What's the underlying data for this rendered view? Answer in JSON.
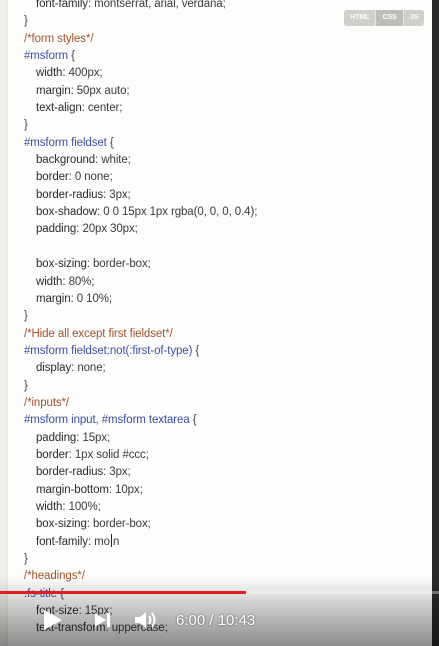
{
  "editor": {
    "language_tabs": [
      "HTML",
      "CSS",
      "JS"
    ],
    "active_tab": "CSS",
    "lines": [
      {
        "indent": 1,
        "parts": [
          [
            "prop",
            "font-family"
          ],
          [
            "punc",
            ": "
          ],
          [
            "val",
            "montserrat, arial, verdana"
          ],
          [
            "punc",
            ";"
          ]
        ]
      },
      {
        "indent": 0,
        "parts": [
          [
            "punc",
            "}"
          ]
        ]
      },
      {
        "indent": 0,
        "parts": [
          [
            "cmt",
            "/*form styles*/"
          ]
        ]
      },
      {
        "indent": 0,
        "parts": [
          [
            "sel",
            "#msform"
          ],
          [
            "punc",
            " {"
          ]
        ]
      },
      {
        "indent": 1,
        "parts": [
          [
            "prop",
            "width"
          ],
          [
            "punc",
            ": "
          ],
          [
            "val",
            "400px"
          ],
          [
            "punc",
            ";"
          ]
        ]
      },
      {
        "indent": 1,
        "parts": [
          [
            "prop",
            "margin"
          ],
          [
            "punc",
            ": "
          ],
          [
            "val",
            "50px auto"
          ],
          [
            "punc",
            ";"
          ]
        ]
      },
      {
        "indent": 1,
        "parts": [
          [
            "prop",
            "text-align"
          ],
          [
            "punc",
            ": "
          ],
          [
            "val",
            "center"
          ],
          [
            "punc",
            ";"
          ]
        ]
      },
      {
        "indent": 0,
        "parts": [
          [
            "punc",
            "}"
          ]
        ]
      },
      {
        "indent": 0,
        "parts": [
          [
            "sel",
            "#msform fieldset"
          ],
          [
            "punc",
            " {"
          ]
        ]
      },
      {
        "indent": 1,
        "parts": [
          [
            "prop",
            "background"
          ],
          [
            "punc",
            ": "
          ],
          [
            "val",
            "white"
          ],
          [
            "punc",
            ";"
          ]
        ]
      },
      {
        "indent": 1,
        "parts": [
          [
            "prop",
            "border"
          ],
          [
            "punc",
            ": "
          ],
          [
            "val",
            "0 none"
          ],
          [
            "punc",
            ";"
          ]
        ]
      },
      {
        "indent": 1,
        "parts": [
          [
            "prop",
            "border-radius"
          ],
          [
            "punc",
            ": "
          ],
          [
            "val",
            "3px"
          ],
          [
            "punc",
            ";"
          ]
        ]
      },
      {
        "indent": 1,
        "parts": [
          [
            "prop",
            "box-shadow"
          ],
          [
            "punc",
            ": "
          ],
          [
            "val",
            "0 0 15px 1px rgba(0, 0, 0, 0.4)"
          ],
          [
            "punc",
            ";"
          ]
        ]
      },
      {
        "indent": 1,
        "parts": [
          [
            "prop",
            "padding"
          ],
          [
            "punc",
            ": "
          ],
          [
            "val",
            "20px 30px"
          ],
          [
            "punc",
            ";"
          ]
        ]
      },
      {
        "indent": 0,
        "parts": []
      },
      {
        "indent": 1,
        "parts": [
          [
            "prop",
            "box-sizing"
          ],
          [
            "punc",
            ": "
          ],
          [
            "val",
            "border-box"
          ],
          [
            "punc",
            ";"
          ]
        ]
      },
      {
        "indent": 1,
        "parts": [
          [
            "prop",
            "width"
          ],
          [
            "punc",
            ": "
          ],
          [
            "val",
            "80%"
          ],
          [
            "punc",
            ";"
          ]
        ]
      },
      {
        "indent": 1,
        "parts": [
          [
            "prop",
            "margin"
          ],
          [
            "punc",
            ": "
          ],
          [
            "val",
            "0 10%"
          ],
          [
            "punc",
            ";"
          ]
        ]
      },
      {
        "indent": 0,
        "parts": [
          [
            "punc",
            "}"
          ]
        ]
      },
      {
        "indent": 0,
        "parts": [
          [
            "cmt",
            "/*Hide all except first fieldset*/"
          ]
        ]
      },
      {
        "indent": 0,
        "parts": [
          [
            "sel",
            "#msform fieldset:not(:first-of-type)"
          ],
          [
            "punc",
            " {"
          ]
        ]
      },
      {
        "indent": 1,
        "parts": [
          [
            "prop",
            "display"
          ],
          [
            "punc",
            ": "
          ],
          [
            "val",
            "none"
          ],
          [
            "punc",
            ";"
          ]
        ]
      },
      {
        "indent": 0,
        "parts": [
          [
            "punc",
            "}"
          ]
        ]
      },
      {
        "indent": 0,
        "parts": [
          [
            "cmt",
            "/*inputs*/"
          ]
        ]
      },
      {
        "indent": 0,
        "parts": [
          [
            "sel",
            "#msform input, #msform textarea"
          ],
          [
            "punc",
            " {"
          ]
        ]
      },
      {
        "indent": 1,
        "parts": [
          [
            "prop",
            "padding"
          ],
          [
            "punc",
            ": "
          ],
          [
            "val",
            "15px"
          ],
          [
            "punc",
            ";"
          ]
        ]
      },
      {
        "indent": 1,
        "parts": [
          [
            "prop",
            "border"
          ],
          [
            "punc",
            ": "
          ],
          [
            "val",
            "1px solid #ccc"
          ],
          [
            "punc",
            ";"
          ]
        ]
      },
      {
        "indent": 1,
        "parts": [
          [
            "prop",
            "border-radius"
          ],
          [
            "punc",
            ": "
          ],
          [
            "val",
            "3px"
          ],
          [
            "punc",
            ";"
          ]
        ]
      },
      {
        "indent": 1,
        "parts": [
          [
            "prop",
            "margin-bottom"
          ],
          [
            "punc",
            ": "
          ],
          [
            "val",
            "10px"
          ],
          [
            "punc",
            ";"
          ]
        ]
      },
      {
        "indent": 1,
        "parts": [
          [
            "prop",
            "width"
          ],
          [
            "punc",
            ": "
          ],
          [
            "val",
            "100%"
          ],
          [
            "punc",
            ";"
          ]
        ]
      },
      {
        "indent": 1,
        "parts": [
          [
            "prop",
            "box-sizing"
          ],
          [
            "punc",
            ": "
          ],
          [
            "val",
            "border-box"
          ],
          [
            "punc",
            ";"
          ]
        ]
      },
      {
        "indent": 1,
        "caret_after": 1,
        "parts": [
          [
            "prop",
            "font-family"
          ],
          [
            "punc",
            ": "
          ],
          [
            "val",
            "mo"
          ],
          [
            "val",
            "n"
          ]
        ]
      },
      {
        "indent": 0,
        "parts": [
          [
            "punc",
            "}"
          ]
        ]
      },
      {
        "indent": 0,
        "parts": [
          [
            "cmt",
            "/*headings*/"
          ]
        ]
      },
      {
        "indent": 0,
        "parts": [
          [
            "sel",
            ".fs-title"
          ],
          [
            "punc",
            " {"
          ]
        ]
      },
      {
        "indent": 1,
        "parts": [
          [
            "prop",
            "font-size"
          ],
          [
            "punc",
            ": "
          ],
          [
            "val",
            "15px"
          ],
          [
            "punc",
            ";"
          ]
        ]
      },
      {
        "indent": 1,
        "parts": [
          [
            "prop",
            "text-transform"
          ],
          [
            "punc",
            ": "
          ],
          [
            "val",
            "uppercase"
          ],
          [
            "punc",
            ";"
          ]
        ]
      }
    ]
  },
  "player": {
    "current_time": "6:00",
    "separator": " / ",
    "duration": "10:43",
    "progress_fraction": 0.5598,
    "accent_color": "#e01e1e",
    "icons": [
      "play-icon",
      "next-icon",
      "volume-icon"
    ]
  }
}
